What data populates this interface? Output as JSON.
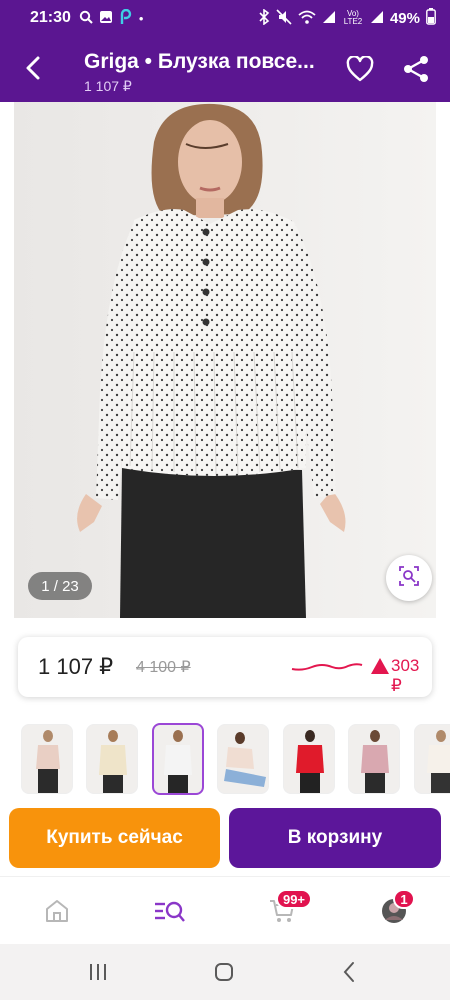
{
  "status_bar": {
    "time": "21:30",
    "dot": "•",
    "network": "Vo) LTE2",
    "battery": "49%"
  },
  "header": {
    "title": "Griga • Блузка повсе...",
    "price": "1 107 ₽"
  },
  "gallery": {
    "counter": "1 / 23"
  },
  "price": {
    "current": "1 107 ₽",
    "old": "4 100 ₽",
    "change": "303 ₽"
  },
  "buttons": {
    "buy_now": "Купить сейчас",
    "add_to_cart": "В корзину"
  },
  "tabbar": {
    "cart_badge": "99+",
    "profile_badge": "1"
  },
  "colors": {
    "brand": "#5b1691",
    "buy_button": "#f8930c",
    "cart_button": "#5c169a",
    "price_up": "#e3174f"
  },
  "icons": [
    "back-arrow-icon",
    "heart-icon",
    "share-icon",
    "visual-search-icon",
    "trend-up-icon",
    "home-icon",
    "catalog-search-icon",
    "cart-icon",
    "profile-avatar-icon",
    "recent-apps-icon",
    "home-nav-icon",
    "back-nav-icon"
  ]
}
